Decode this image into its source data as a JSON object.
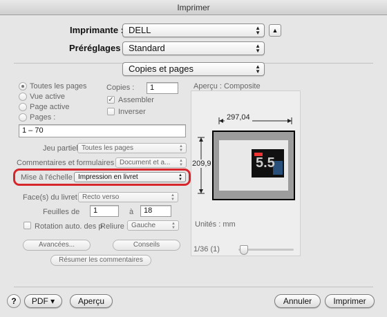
{
  "window": {
    "title": "Imprimer"
  },
  "printer": {
    "label": "Imprimante :",
    "value": "DELL"
  },
  "presets": {
    "label": "Préréglages :",
    "value": "Standard"
  },
  "panel_selector": {
    "value": "Copies et pages"
  },
  "pages": {
    "options": [
      "Toutes les pages",
      "Vue active",
      "Page active",
      "Pages :"
    ],
    "selected_index": 0,
    "range_value": "1 – 70"
  },
  "copies": {
    "label": "Copies :",
    "value": "1"
  },
  "collate": {
    "label": "Assembler",
    "checked": true
  },
  "reverse": {
    "label": "Inverser",
    "checked": false
  },
  "partial_set": {
    "label": "Jeu partiel :",
    "value": "Toutes les pages"
  },
  "comments": {
    "label": "Commentaires et formulaires :",
    "value": "Document et a..."
  },
  "scaling": {
    "label": "Mise à l'échelle :",
    "value": "Impression en livret"
  },
  "booklet": {
    "sides_label": "Face(s) du livret :",
    "sides_value": "Recto verso",
    "sheets_label": "Feuilles de",
    "sheets_from": "1",
    "sheets_to_label": "à",
    "sheets_to": "18",
    "auto_rotate_label": "Rotation auto. des p",
    "auto_rotate_checked": false,
    "binding_label": "Reliure :",
    "binding_value": "Gauche"
  },
  "buttons_mid": {
    "advanced": "Avancées...",
    "summarize": "Conseils",
    "summarize_comments": "Résumer les commentaires"
  },
  "preview": {
    "label": "Aperçu : Composite",
    "width_dim": "297,04",
    "height_dim": "209,9",
    "units": "Unités : mm",
    "page_counter": "1/36 (1)",
    "thumb_text": "5.5"
  },
  "footer": {
    "help": "?",
    "pdf": "PDF ▾",
    "preview": "Aperçu",
    "cancel": "Annuler",
    "print": "Imprimer"
  },
  "colors": {
    "highlight_ring": "#d7262b"
  }
}
